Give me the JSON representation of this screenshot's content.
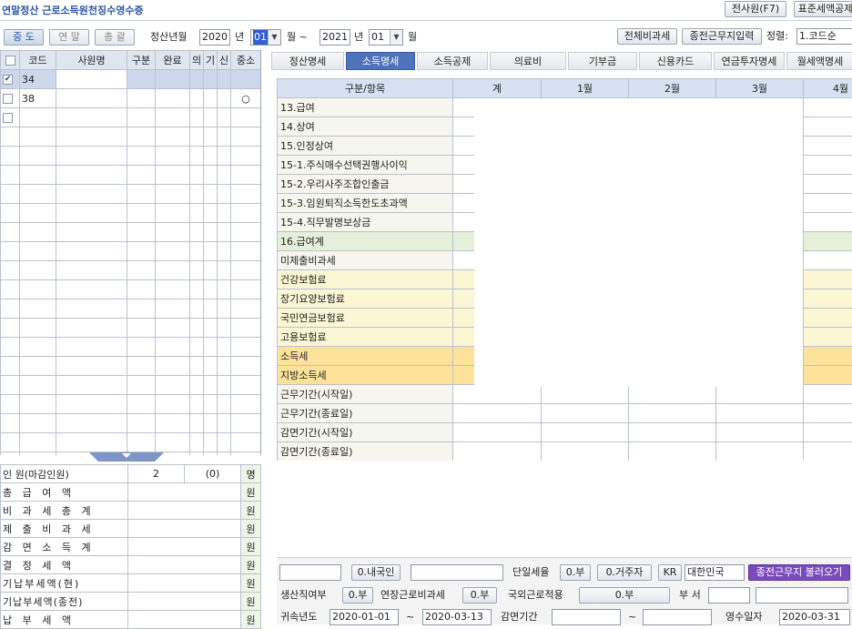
{
  "app": {
    "title": "연말정산 근로소득원천징수영수증",
    "top_buttons": [
      "전사원(F7)",
      "표준세액공제"
    ]
  },
  "toolbar": {
    "mode_tabs": [
      "중 도",
      "연 말",
      "총 괄"
    ],
    "period_label": "정산년월",
    "start_year": "2020",
    "year_unit": "년",
    "start_month": "01",
    "month_unit": "월 ~",
    "end_year": "2021",
    "end_month": "01",
    "end_month_unit": "월",
    "right_buttons": [
      "전체비과세",
      "종전근무지입력"
    ],
    "sort_label": "정렬:",
    "sort_value": "1.코드순"
  },
  "employee_grid": {
    "columns": [
      "코드",
      "사원명",
      "구분",
      "완료",
      "의",
      "기",
      "신",
      "중소"
    ],
    "rows": [
      {
        "checked": true,
        "code": "34",
        "name": "",
        "sme": ""
      },
      {
        "checked": false,
        "code": "38",
        "name": "",
        "sme": "○"
      },
      {
        "checked": false,
        "code": "",
        "name": "",
        "sme": ""
      }
    ]
  },
  "summary": {
    "rows": [
      {
        "label": "인 원(마감인원)",
        "v1": "2",
        "v2": "(0)",
        "unit": "명"
      },
      {
        "label": "총 급 여 액",
        "v1": "",
        "v2": "",
        "unit": "원"
      },
      {
        "label": "비 과 세 총 계",
        "v1": "",
        "v2": "",
        "unit": "원"
      },
      {
        "label": "제 출 비 과 세",
        "v1": "",
        "v2": "",
        "unit": "원"
      },
      {
        "label": "감 면 소 득 계",
        "v1": "",
        "v2": "",
        "unit": "원"
      },
      {
        "label": "결 정 세 액",
        "v1": "",
        "v2": "",
        "unit": "원"
      },
      {
        "label": "기납부세액(현)",
        "v1": "",
        "v2": "",
        "unit": "원"
      },
      {
        "label": "기납부세액(종전)",
        "v1": "",
        "v2": "",
        "unit": "원"
      },
      {
        "label": "납 부 세 액",
        "v1": "",
        "v2": "",
        "unit": "원"
      }
    ]
  },
  "tabs": [
    "정산명세",
    "소득명세",
    "소득공제",
    "의료비",
    "기부금",
    "신용카드",
    "연금투자명세",
    "월세액명세"
  ],
  "active_tab": "소득명세",
  "income_grid": {
    "columns": [
      "구분/항목",
      "계",
      "1월",
      "2월",
      "3월",
      "4월"
    ],
    "rows": [
      {
        "label": "13.급여",
        "style": "plain"
      },
      {
        "label": "14.상여",
        "style": "plain"
      },
      {
        "label": "15.인정상여",
        "style": "plain"
      },
      {
        "label": "15-1.주식매수선택권행사이익",
        "style": "plain"
      },
      {
        "label": "15-2.우리사주조합인출금",
        "style": "plain"
      },
      {
        "label": "15-3.임원퇴직소득한도초과액",
        "style": "plain"
      },
      {
        "label": "15-4.직무발명보상금",
        "style": "plain"
      },
      {
        "label": "16.급여계",
        "style": "green"
      },
      {
        "label": "미제출비과세",
        "style": "plain"
      },
      {
        "label": "건강보험료",
        "style": "yellow"
      },
      {
        "label": "장기요양보험료",
        "style": "yellow"
      },
      {
        "label": "국민연금보험료",
        "style": "yellow"
      },
      {
        "label": "고용보험료",
        "style": "yellow"
      },
      {
        "label": "소득세",
        "style": "orange"
      },
      {
        "label": "지방소득세",
        "style": "orange"
      },
      {
        "label": "근무기간(시작일)",
        "style": "plain"
      },
      {
        "label": "근무기간(종료일)",
        "style": "plain"
      },
      {
        "label": "감면기간(시작일)",
        "style": "plain"
      },
      {
        "label": "감면기간(종료일)",
        "style": "plain"
      },
      {
        "label": "",
        "style": "empty"
      },
      {
        "label": "",
        "style": "empty"
      },
      {
        "label": "",
        "style": "empty"
      },
      {
        "label": "",
        "style": "empty"
      }
    ]
  },
  "bottom": {
    "nationality": "0.내국인",
    "single_tax_label": "단일세율",
    "single_tax_value": "0.부",
    "residence": "0.거주자",
    "country_code": "KR",
    "country_name": "대한민국",
    "load_prev_button": "종전근무지 불러오기",
    "production_label": "생산직여부",
    "production_value": "0.부",
    "overtime_label": "연장근로비과세",
    "overtime_value": "0.부",
    "foreign_label": "국외근로적용",
    "foreign_value": "0.부",
    "dept_label": "부 서",
    "belong_year_label": "귀속년도",
    "belong_from": "2020-01-01",
    "tilde": "~",
    "belong_to": "2020-03-13",
    "reduction_label": "감면기간",
    "reduction_tilde": "~",
    "receipt_label": "영수일자",
    "receipt_date": "2020-03-31"
  }
}
